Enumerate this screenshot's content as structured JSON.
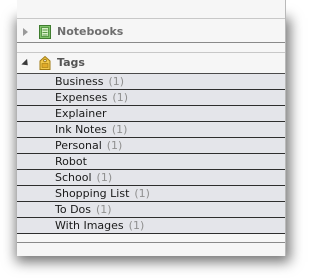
{
  "notebooks": {
    "title": "Notebooks"
  },
  "tags": {
    "title": "Tags",
    "items": [
      {
        "label": "Business",
        "count": "(1)"
      },
      {
        "label": "Expenses",
        "count": "(1)"
      },
      {
        "label": "Explainer",
        "count": ""
      },
      {
        "label": "Ink Notes",
        "count": "(1)"
      },
      {
        "label": "Personal",
        "count": "(1)"
      },
      {
        "label": "Robot",
        "count": ""
      },
      {
        "label": "School",
        "count": "(1)"
      },
      {
        "label": "Shopping List",
        "count": "(1)"
      },
      {
        "label": "To Dos",
        "count": "(1)"
      },
      {
        "label": "With Images",
        "count": "(1)"
      }
    ]
  }
}
